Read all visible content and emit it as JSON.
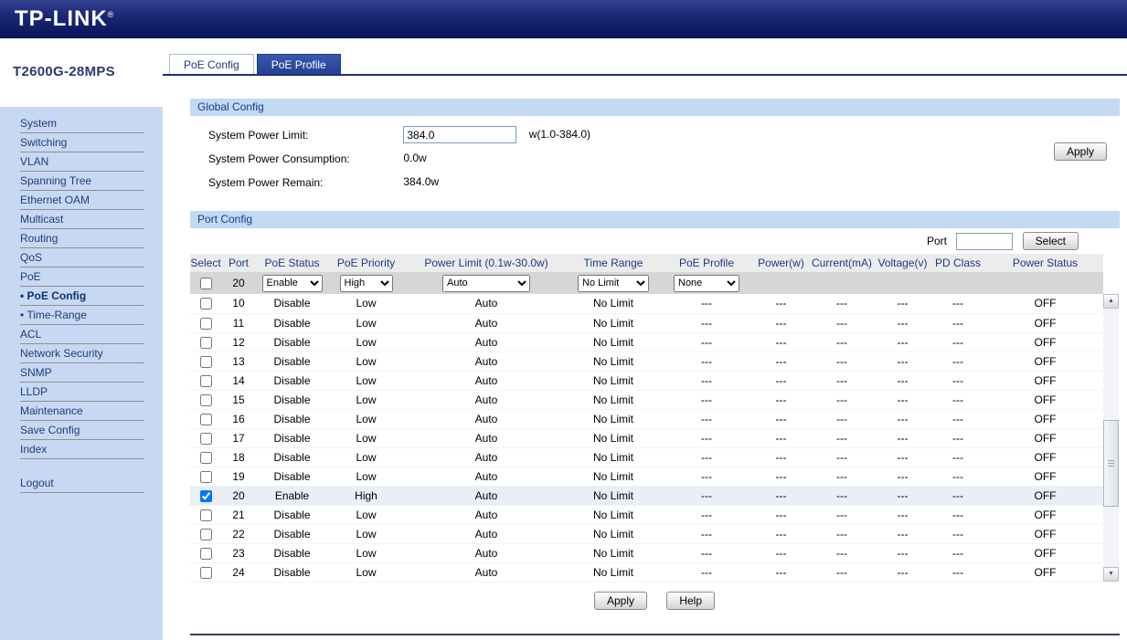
{
  "brand": {
    "logo": "TP-LINK",
    "registered": "®"
  },
  "sidebar": {
    "model": "T2600G-28MPS",
    "items": [
      {
        "label": "System"
      },
      {
        "label": "Switching"
      },
      {
        "label": "VLAN"
      },
      {
        "label": "Spanning Tree"
      },
      {
        "label": "Ethernet OAM"
      },
      {
        "label": "Multicast"
      },
      {
        "label": "Routing"
      },
      {
        "label": "QoS"
      },
      {
        "label": "PoE"
      },
      {
        "label": "• PoE Config",
        "active": true
      },
      {
        "label": "• Time-Range"
      },
      {
        "label": "ACL"
      },
      {
        "label": "Network Security"
      },
      {
        "label": "SNMP"
      },
      {
        "label": "LLDP"
      },
      {
        "label": "Maintenance"
      },
      {
        "label": "Save Config"
      },
      {
        "label": "Index"
      }
    ],
    "logout": "Logout"
  },
  "tabs": [
    {
      "label": "PoE Config",
      "active": true
    },
    {
      "label": "PoE Profile",
      "active": false
    }
  ],
  "global_config": {
    "title": "Global Config",
    "power_limit_label": "System Power Limit:",
    "power_limit_value": "384.0",
    "power_limit_range": "w(1.0-384.0)",
    "consumption_label": "System Power Consumption:",
    "consumption_value": "0.0w",
    "remain_label": "System Power Remain:",
    "remain_value": "384.0w",
    "apply_label": "Apply"
  },
  "port_config": {
    "title": "Port Config",
    "port_label": "Port",
    "port_value": "",
    "select_label": "Select",
    "table": {
      "headers": [
        "Select",
        "Port",
        "PoE Status",
        "PoE Priority",
        "Power Limit (0.1w-30.0w)",
        "Time Range",
        "PoE Profile",
        "Power(w)",
        "Current(mA)",
        "Voltage(v)",
        "PD Class",
        "Power Status"
      ],
      "edit_row": {
        "port": "20",
        "poe_status": "Enable",
        "poe_priority": "High",
        "power_limit": "Auto",
        "time_range": "No Limit",
        "poe_profile": "None"
      },
      "rows": [
        {
          "selected": false,
          "port": "10",
          "poe_status": "Disable",
          "poe_priority": "Low",
          "power_limit": "Auto",
          "time_range": "No Limit",
          "poe_profile": "---",
          "power": "---",
          "current": "---",
          "voltage": "---",
          "pd_class": "---",
          "power_status": "OFF"
        },
        {
          "selected": false,
          "port": "11",
          "poe_status": "Disable",
          "poe_priority": "Low",
          "power_limit": "Auto",
          "time_range": "No Limit",
          "poe_profile": "---",
          "power": "---",
          "current": "---",
          "voltage": "---",
          "pd_class": "---",
          "power_status": "OFF"
        },
        {
          "selected": false,
          "port": "12",
          "poe_status": "Disable",
          "poe_priority": "Low",
          "power_limit": "Auto",
          "time_range": "No Limit",
          "poe_profile": "---",
          "power": "---",
          "current": "---",
          "voltage": "---",
          "pd_class": "---",
          "power_status": "OFF"
        },
        {
          "selected": false,
          "port": "13",
          "poe_status": "Disable",
          "poe_priority": "Low",
          "power_limit": "Auto",
          "time_range": "No Limit",
          "poe_profile": "---",
          "power": "---",
          "current": "---",
          "voltage": "---",
          "pd_class": "---",
          "power_status": "OFF"
        },
        {
          "selected": false,
          "port": "14",
          "poe_status": "Disable",
          "poe_priority": "Low",
          "power_limit": "Auto",
          "time_range": "No Limit",
          "poe_profile": "---",
          "power": "---",
          "current": "---",
          "voltage": "---",
          "pd_class": "---",
          "power_status": "OFF"
        },
        {
          "selected": false,
          "port": "15",
          "poe_status": "Disable",
          "poe_priority": "Low",
          "power_limit": "Auto",
          "time_range": "No Limit",
          "poe_profile": "---",
          "power": "---",
          "current": "---",
          "voltage": "---",
          "pd_class": "---",
          "power_status": "OFF"
        },
        {
          "selected": false,
          "port": "16",
          "poe_status": "Disable",
          "poe_priority": "Low",
          "power_limit": "Auto",
          "time_range": "No Limit",
          "poe_profile": "---",
          "power": "---",
          "current": "---",
          "voltage": "---",
          "pd_class": "---",
          "power_status": "OFF"
        },
        {
          "selected": false,
          "port": "17",
          "poe_status": "Disable",
          "poe_priority": "Low",
          "power_limit": "Auto",
          "time_range": "No Limit",
          "poe_profile": "---",
          "power": "---",
          "current": "---",
          "voltage": "---",
          "pd_class": "---",
          "power_status": "OFF"
        },
        {
          "selected": false,
          "port": "18",
          "poe_status": "Disable",
          "poe_priority": "Low",
          "power_limit": "Auto",
          "time_range": "No Limit",
          "poe_profile": "---",
          "power": "---",
          "current": "---",
          "voltage": "---",
          "pd_class": "---",
          "power_status": "OFF"
        },
        {
          "selected": false,
          "port": "19",
          "poe_status": "Disable",
          "poe_priority": "Low",
          "power_limit": "Auto",
          "time_range": "No Limit",
          "poe_profile": "---",
          "power": "---",
          "current": "---",
          "voltage": "---",
          "pd_class": "---",
          "power_status": "OFF"
        },
        {
          "selected": true,
          "port": "20",
          "poe_status": "Enable",
          "poe_priority": "High",
          "power_limit": "Auto",
          "time_range": "No Limit",
          "poe_profile": "---",
          "power": "---",
          "current": "---",
          "voltage": "---",
          "pd_class": "---",
          "power_status": "OFF"
        },
        {
          "selected": false,
          "port": "21",
          "poe_status": "Disable",
          "poe_priority": "Low",
          "power_limit": "Auto",
          "time_range": "No Limit",
          "poe_profile": "---",
          "power": "---",
          "current": "---",
          "voltage": "---",
          "pd_class": "---",
          "power_status": "OFF"
        },
        {
          "selected": false,
          "port": "22",
          "poe_status": "Disable",
          "poe_priority": "Low",
          "power_limit": "Auto",
          "time_range": "No Limit",
          "poe_profile": "---",
          "power": "---",
          "current": "---",
          "voltage": "---",
          "pd_class": "---",
          "power_status": "OFF"
        },
        {
          "selected": false,
          "port": "23",
          "poe_status": "Disable",
          "poe_priority": "Low",
          "power_limit": "Auto",
          "time_range": "No Limit",
          "poe_profile": "---",
          "power": "---",
          "current": "---",
          "voltage": "---",
          "pd_class": "---",
          "power_status": "OFF"
        },
        {
          "selected": false,
          "port": "24",
          "poe_status": "Disable",
          "poe_priority": "Low",
          "power_limit": "Auto",
          "time_range": "No Limit",
          "poe_profile": "---",
          "power": "---",
          "current": "---",
          "voltage": "---",
          "pd_class": "---",
          "power_status": "OFF"
        }
      ]
    },
    "apply_label": "Apply",
    "help_label": "Help"
  },
  "icons": {
    "scroll_up": "▲",
    "scroll_down": "▼"
  }
}
